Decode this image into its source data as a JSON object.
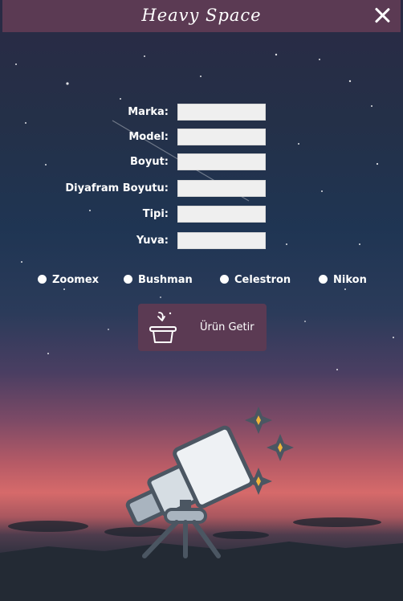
{
  "window": {
    "title": "Heavy Space"
  },
  "form": {
    "fields": [
      {
        "label": "Marka:",
        "value": ""
      },
      {
        "label": "Model:",
        "value": ""
      },
      {
        "label": "Boyut:",
        "value": ""
      },
      {
        "label": "Diyafram Boyutu:",
        "value": ""
      },
      {
        "label": "Tipi:",
        "value": ""
      },
      {
        "label": "Yuva:",
        "value": ""
      }
    ]
  },
  "brands": {
    "options": [
      {
        "label": "Zoomex",
        "selected": false
      },
      {
        "label": "Bushman",
        "selected": false
      },
      {
        "label": "Celestron",
        "selected": false
      },
      {
        "label": "Nikon",
        "selected": false
      }
    ]
  },
  "action": {
    "label": "Ürün Getir",
    "icon": "basket-arrow-icon"
  },
  "illustration": {
    "icon": "telescope-icon",
    "sparkles": "sparkle-icon"
  },
  "colors": {
    "titlebar": "#5b3a53",
    "button": "#5b3a53",
    "sparkle": "#f0b43a",
    "telescope": "#4b5662"
  }
}
